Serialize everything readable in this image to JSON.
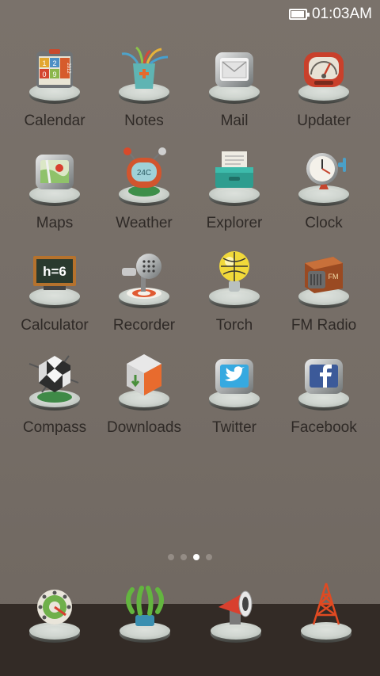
{
  "status_bar": {
    "time": "01:03AM",
    "battery_icon": "battery-full-icon"
  },
  "apps": [
    {
      "label": "Calendar",
      "icon": "calendar-icon",
      "icon_text": [
        "1",
        "2",
        "0",
        "9",
        "2012"
      ]
    },
    {
      "label": "Notes",
      "icon": "notes-icon"
    },
    {
      "label": "Mail",
      "icon": "mail-icon"
    },
    {
      "label": "Updater",
      "icon": "updater-icon"
    },
    {
      "label": "Maps",
      "icon": "maps-icon"
    },
    {
      "label": "Weather",
      "icon": "weather-icon",
      "icon_text": [
        "24C"
      ]
    },
    {
      "label": "Explorer",
      "icon": "explorer-icon"
    },
    {
      "label": "Clock",
      "icon": "clock-icon"
    },
    {
      "label": "Calculator",
      "icon": "calculator-icon",
      "icon_text": [
        "h=6"
      ]
    },
    {
      "label": "Recorder",
      "icon": "recorder-icon"
    },
    {
      "label": "Torch",
      "icon": "torch-icon"
    },
    {
      "label": "FM Radio",
      "icon": "fm-radio-icon",
      "icon_text": [
        "FM"
      ]
    },
    {
      "label": "Compass",
      "icon": "compass-icon"
    },
    {
      "label": "Downloads",
      "icon": "downloads-icon"
    },
    {
      "label": "Twitter",
      "icon": "twitter-icon"
    },
    {
      "label": "Facebook",
      "icon": "facebook-icon"
    }
  ],
  "page_indicator": {
    "pages": 4,
    "current": 3
  },
  "dock": [
    {
      "icon": "phone-dialer-icon"
    },
    {
      "icon": "contacts-icon"
    },
    {
      "icon": "messaging-icon"
    },
    {
      "icon": "browser-tower-icon"
    }
  ],
  "colors": {
    "background": "#77706a",
    "dock_background": "#332b26",
    "label_text": "#2f2a27",
    "status_text": "#ffffff"
  }
}
